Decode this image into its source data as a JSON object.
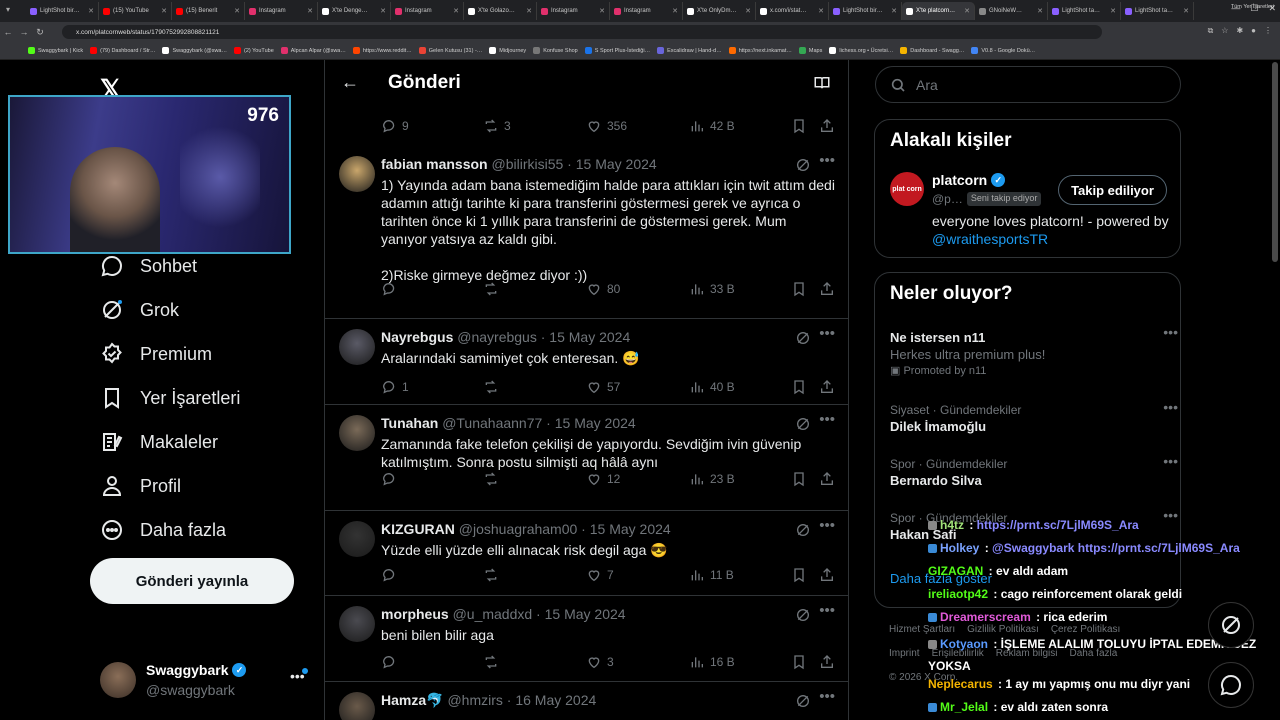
{
  "browser": {
    "tabs": [
      {
        "label": "LightShot bir…",
        "color": "#8a60ff"
      },
      {
        "label": "(15) YouTube",
        "color": "#ff0000"
      },
      {
        "label": "(15) Benerit",
        "color": "#ff0000"
      },
      {
        "label": "Instagram",
        "color": "#e1306c"
      },
      {
        "label": "X'te Denge…",
        "color": "#ffffff"
      },
      {
        "label": "Instagram",
        "color": "#e1306c"
      },
      {
        "label": "X'te Golazo…",
        "color": "#ffffff"
      },
      {
        "label": "Instagram",
        "color": "#e1306c"
      },
      {
        "label": "Instagram",
        "color": "#e1306c"
      },
      {
        "label": "X'te OnlyDm…",
        "color": "#ffffff"
      },
      {
        "label": "x.com/i/stat…",
        "color": "#ffffff"
      },
      {
        "label": "LightShot bir…",
        "color": "#8a60ff"
      },
      {
        "label": "X'te platcorn…",
        "color": "#ffffff",
        "active": true
      },
      {
        "label": "GNoiNeW…",
        "color": "#888888"
      },
      {
        "label": "LightShot ta…",
        "color": "#8a60ff"
      },
      {
        "label": "LightShot ta…",
        "color": "#8a60ff"
      }
    ],
    "url": "x.com/platcornweb/status/1790752992808821121",
    "bookmarks": [
      {
        "label": "Swaggybark | Kick",
        "color": "#53fc18"
      },
      {
        "label": "(79) Dashboard / Str…",
        "color": "#ff0000"
      },
      {
        "label": "Swaggybark (@swa…",
        "color": "#ffffff"
      },
      {
        "label": "(2) YouTube",
        "color": "#ff0000"
      },
      {
        "label": "Alpcan Alpar (@swa…",
        "color": "#e1306c"
      },
      {
        "label": "https://www.reddit…",
        "color": "#ff4500"
      },
      {
        "label": "Gelen Kutusu (31) -…",
        "color": "#ea4335"
      },
      {
        "label": "Midjourney",
        "color": "#ffffff"
      },
      {
        "label": "Konfuse Shop",
        "color": "#777777"
      },
      {
        "label": "S Sport Plus-İstediği…",
        "color": "#1a73e8"
      },
      {
        "label": "Excalidraw | Hand-d…",
        "color": "#6965db"
      },
      {
        "label": "https://next.inkamat…",
        "color": "#ff6a00"
      },
      {
        "label": "Maps",
        "color": "#34a853"
      },
      {
        "label": "lichess.org • Ücretsi…",
        "color": "#ffffff"
      },
      {
        "label": "Dashboard - Swagg…",
        "color": "#f4b400"
      },
      {
        "label": "V0.8 - Google Dokü…",
        "color": "#4285f4"
      }
    ],
    "all_bookmarks": "Tüm Yer İşaretleri"
  },
  "stream": {
    "viewer_count": "976"
  },
  "nav": {
    "items": [
      {
        "label": "Sohbet",
        "icon": "chat-icon"
      },
      {
        "label": "Grok",
        "icon": "grok-icon"
      },
      {
        "label": "Premium",
        "icon": "premium-icon"
      },
      {
        "label": "Yer İşaretleri",
        "icon": "bookmark-icon"
      },
      {
        "label": "Makaleler",
        "icon": "articles-icon"
      },
      {
        "label": "Profil",
        "icon": "profile-icon"
      },
      {
        "label": "Daha fazla",
        "icon": "more-icon"
      }
    ],
    "post_button": "Gönderi yayınla",
    "account": {
      "name": "Swaggybark",
      "handle": "@swaggybark"
    }
  },
  "center": {
    "title": "Gönderi",
    "top_actions": {
      "replies": "9",
      "reposts": "3",
      "likes": "356",
      "views": "42 B"
    },
    "replies": [
      {
        "name": "fabian mansson",
        "handle": "@bilirkisi55",
        "date": "15 May 2024",
        "text": "1) Yayında adam bana istemediğim halde para attıkları için twit attım dedi adamın attığı tarihte ki para transferini göstermesi gerek ve ayrıca o tarihten önce ki 1 yıllık para transferini de göstermesi gerek. Mum yanıyor yatsıya az kaldı gibi.\n\n2)Riske girmeye değmez diyor :))",
        "replies": "",
        "reposts": "",
        "likes": "80",
        "views": "33 B",
        "avatar": "#c9a66b"
      },
      {
        "name": "Nayrebgus",
        "handle": "@nayrebgus",
        "date": "15 May 2024",
        "text": "Aralarındaki samimiyet çok enteresan. 😅",
        "replies": "1",
        "reposts": "",
        "likes": "57",
        "views": "40 B",
        "avatar": "#5a5a66"
      },
      {
        "name": "Tunahan",
        "handle": "@Tunahaann77",
        "date": "15 May 2024",
        "text": "Zamanında fake telefon çekilişi de yapıyordu. Sevdiğim ivin güvenip katılmıştım. Sonra postu silmişti aq hâlâ aynı",
        "replies": "",
        "reposts": "",
        "likes": "12",
        "views": "23 B",
        "avatar": "#7a6a58"
      },
      {
        "name": "KIZGURAN",
        "handle": "@joshuagraham00",
        "date": "15 May 2024",
        "text": "Yüzde elli yüzde elli alınacak risk degil aga 😎",
        "replies": "",
        "reposts": "",
        "likes": "7",
        "views": "11 B",
        "avatar": "#333333"
      },
      {
        "name": "morpheus",
        "handle": "@u_maddxd",
        "date": "15 May 2024",
        "text": "beni bilen bilir aga",
        "replies": "",
        "reposts": "",
        "likes": "3",
        "views": "16 B",
        "avatar": "#4a4a50"
      },
      {
        "name": "Hamza🐬",
        "handle": "@hmzirs",
        "date": "16 May 2024",
        "text": "",
        "replies": "",
        "reposts": "",
        "likes": "",
        "views": "",
        "avatar": "#6a5a4a"
      }
    ]
  },
  "right": {
    "search_placeholder": "Ara",
    "related_title": "Alakalı kişiler",
    "related": {
      "name": "platcorn",
      "handle": "@p…",
      "follows_you": "Seni takip ediyor",
      "button": "Takip ediliyor",
      "bio_text": "everyone loves platcorn! - powered by",
      "bio_link": "@wraithesportsTR",
      "avatar_text": "plat corn"
    },
    "trends_title": "Neler oluyor?",
    "trends": [
      {
        "context": "",
        "title": "Ne istersen n11",
        "sub": "Herkes ultra premium plus!",
        "promo": "Promoted by n11"
      },
      {
        "context": "Siyaset · Gündemdekiler",
        "title": "Dilek İmamoğlu"
      },
      {
        "context": "Spor · Gündemdekiler",
        "title": "Bernardo Silva"
      },
      {
        "context": "Spor · Gündemdekiler",
        "title": "Hakan Safi"
      }
    ],
    "show_more": "Daha fazla göster",
    "footer": [
      "Hizmet Şartları",
      "Gizlilik Politikası",
      "Çerez Politikası",
      "Imprint",
      "Erişilebilirlik",
      "Reklam bilgisi",
      "Daha fazla",
      "© 2026 X Corp."
    ]
  },
  "chat": [
    {
      "user": "h4tz",
      "color": "#a2e37a",
      "msg": "https://prnt.sc/7LjlM69S_Ara",
      "msgcolor": "#8a8aff",
      "badge": "#888888"
    },
    {
      "user": "Holkey",
      "color": "#7aa2ff",
      "msg": "@Swaggybark https://prnt.sc/7LjlM69S_Ara",
      "msgcolor": "#8a8aff",
      "badge": "#3a8ad6"
    },
    {
      "user": "GIZAGAN",
      "color": "#53fc18",
      "msg": "ev aldı adam",
      "msgcolor": "#ffffff",
      "badge": ""
    },
    {
      "user": "ireliaotp42",
      "color": "#53fc18",
      "msg": "cago reinforcement olarak geldi",
      "msgcolor": "#ffffff",
      "badge": ""
    },
    {
      "user": "Dreamerscream",
      "color": "#e05ad8",
      "msg": "rica ederim",
      "msgcolor": "#ffffff",
      "badge": "#3a8ad6"
    },
    {
      "user": "Kotyaon",
      "color": "#5a9aff",
      "msg": "İŞLEME ALALIM TOLUYU İPTAL EDEMİYCEZ YOKSA",
      "msgcolor": "#ffffff",
      "badge": "#888888"
    },
    {
      "user": "Neplecarus",
      "color": "#f4b400",
      "msg": "1 ay mı yapmış onu mu diyr yani",
      "msgcolor": "#ffffff",
      "badge": ""
    },
    {
      "user": "Mr_Jelal",
      "color": "#53fc18",
      "msg": "ev aldı zaten sonra",
      "msgcolor": "#ffffff",
      "badge": "#3a8ad6"
    }
  ]
}
